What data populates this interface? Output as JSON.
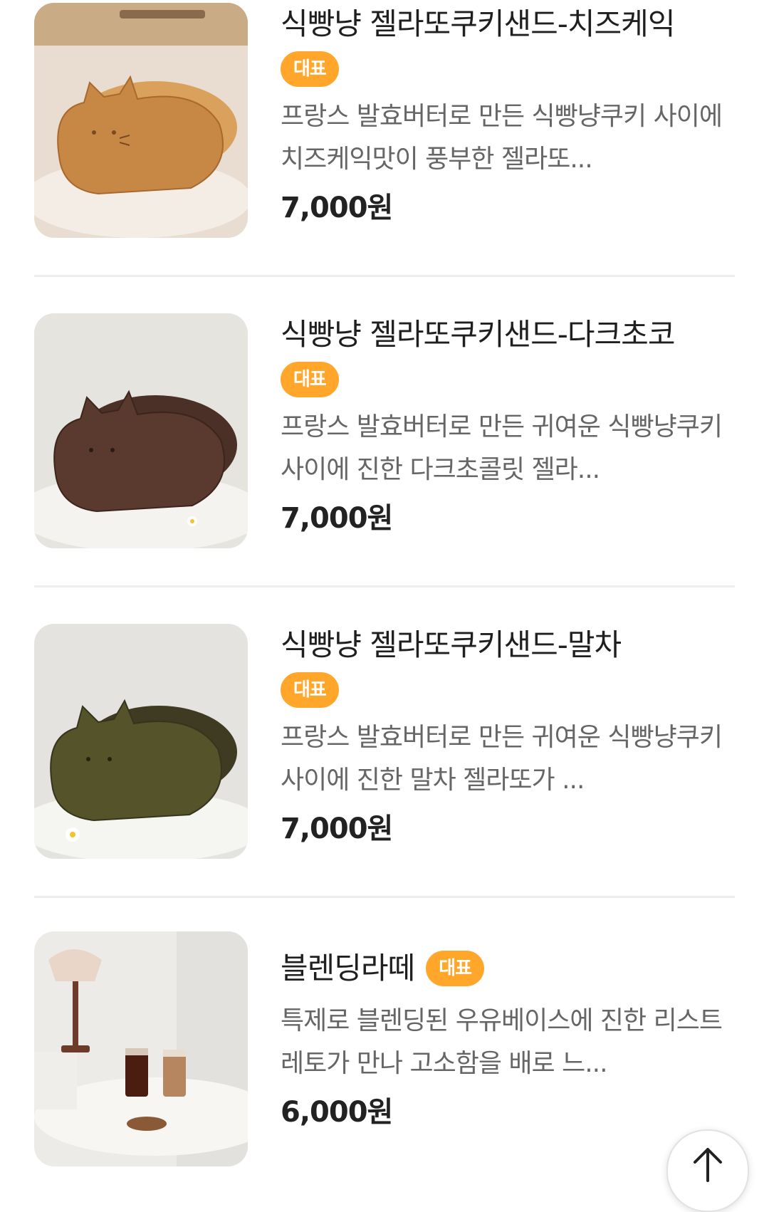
{
  "menu": {
    "items": [
      {
        "title": "식빵냥 젤라또쿠키샌드-치즈케익",
        "badge": "대표",
        "description": "프랑스 발효버터로 만든 식빵냥쿠키 사이에 치즈케익맛이 풍부한 젤라또...",
        "price": "7,000원",
        "image": "cat-cookie-cheesecake"
      },
      {
        "title": "식빵냥 젤라또쿠키샌드-다크초코",
        "badge": "대표",
        "description": "프랑스 발효버터로 만든 귀여운 식빵냥쿠키 사이에 진한 다크초콜릿 젤라...",
        "price": "7,000원",
        "image": "cat-cookie-dark-chocolate"
      },
      {
        "title": "식빵냥 젤라또쿠키샌드-말차",
        "badge": "대표",
        "description": "프랑스 발효버터로 만든 귀여운 식빵냥쿠키 사이에 진한 말차 젤라또가 ...",
        "price": "7,000원",
        "image": "cat-cookie-matcha"
      },
      {
        "title": "블렌딩라떼",
        "badge": "대표",
        "description": "특제로 블렌딩된 우유베이스에 진한 리스트레토가 만나 고소함을 배로 느...",
        "price": "6,000원",
        "image": "blending-latte"
      }
    ]
  },
  "scroll_top": {
    "icon": "arrow-up-icon"
  },
  "colors": {
    "badge": "#ffa62b",
    "divider": "#eeeeee",
    "description": "#666666"
  }
}
